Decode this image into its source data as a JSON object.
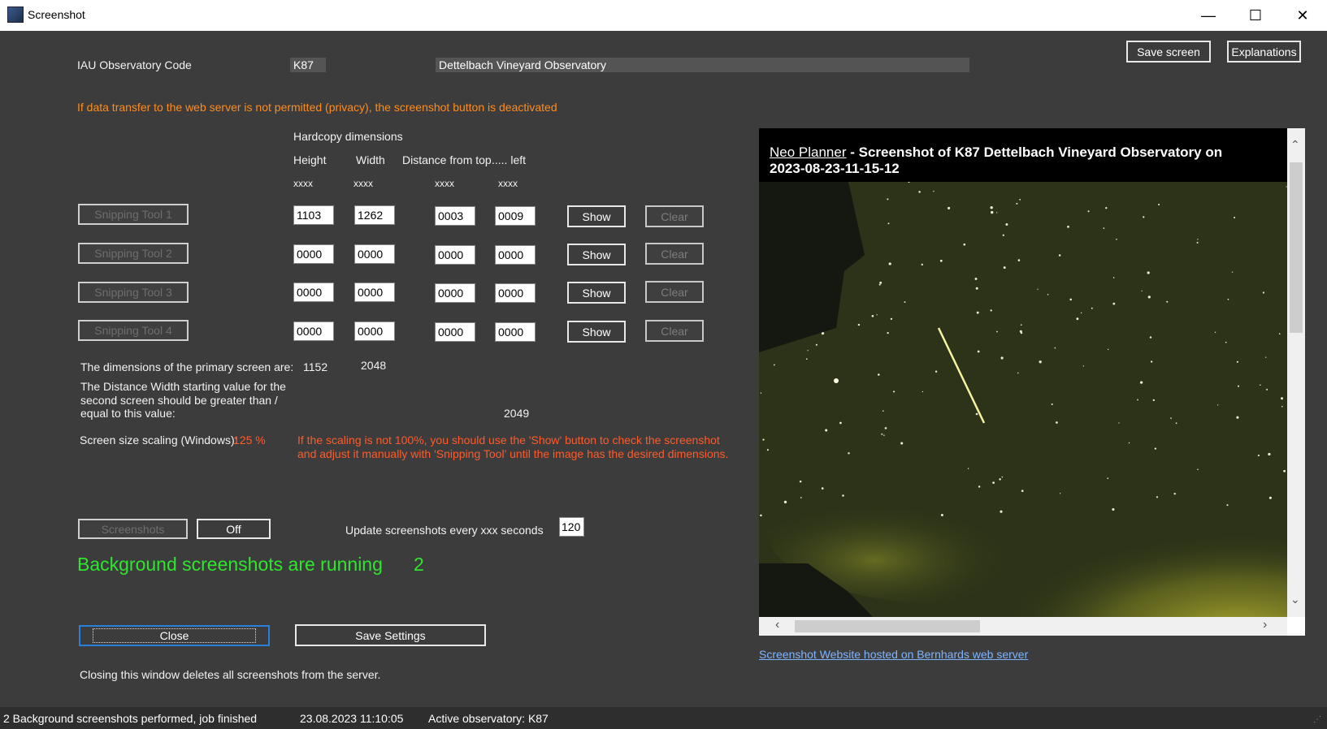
{
  "window": {
    "title": "Screenshot"
  },
  "header": {
    "code_label": "IAU Observatory Code",
    "code_value": "K87",
    "observatory_name": "Dettelbach Vineyard Observatory",
    "save_screen": "Save screen",
    "explanations": "Explanations"
  },
  "privacy_notice": "If data transfer to the web server is not permitted (privacy), the screenshot button is deactivated",
  "hardcopy": {
    "title": "Hardcopy dimensions",
    "col_height": "Height",
    "col_width": "Width",
    "col_top": "Distance from top",
    "col_left": "..... left",
    "placeholder": "xxxx",
    "rows": [
      {
        "tool": "Snipping Tool 1",
        "height": "1103",
        "width": "1262",
        "top": "0003",
        "left": "0009"
      },
      {
        "tool": "Snipping Tool 2",
        "height": "0000",
        "width": "0000",
        "top": "0000",
        "left": "0000"
      },
      {
        "tool": "Snipping Tool 3",
        "height": "0000",
        "width": "0000",
        "top": "0000",
        "left": "0000"
      },
      {
        "tool": "Snipping Tool 4",
        "height": "0000",
        "width": "0000",
        "top": "0000",
        "left": "0000"
      }
    ],
    "show_label": "Show",
    "clear_label": "Clear"
  },
  "primary_screen": {
    "label": "The dimensions of the primary screen are:",
    "height": "1152",
    "width": "2048"
  },
  "distance_width": {
    "label_line1": "The Distance Width starting value for the",
    "label_line2": "second screen should be greater than /",
    "label_line3": "equal to this value:",
    "value": "2049"
  },
  "scaling": {
    "label": "Screen size scaling (Windows):",
    "value": "125 %",
    "warning_line1": "If the scaling is not 100%, you should use the 'Show' button to check the screenshot",
    "warning_line2": "and adjust it manually with 'Snipping Tool' until the image has the desired dimensions."
  },
  "screenshots": {
    "button": "Screenshots",
    "off": "Off",
    "update_label": "Update screenshots every xxx seconds",
    "update_value": "120",
    "running_label": "Background screenshots are running",
    "running_count": "2"
  },
  "footer": {
    "close": "Close",
    "save_settings": "Save Settings",
    "note": "Closing this window deletes all screenshots from the server.",
    "website_link": "Screenshot Website hosted on Bernhards web server"
  },
  "preview": {
    "app_link": "Neo Planner",
    "caption_line1": " -  Screenshot of K87 Dettelbach Vineyard Observatory on",
    "caption_line2": "2023-08-23-11-15-12",
    "colors": {
      "sky": "#2c3318",
      "cloud": "#9fa22a",
      "meteor": "#f5f2a0"
    }
  },
  "status": {
    "message": "2 Background screenshots performed, job finished",
    "timestamp": "23.08.2023 11:10:05",
    "active": "Active observatory: K87"
  }
}
